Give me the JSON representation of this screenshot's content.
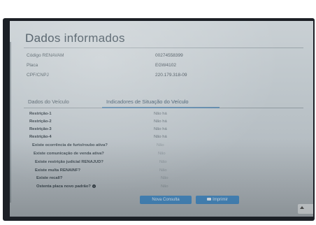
{
  "page": {
    "title": "Dados informados"
  },
  "info": [
    {
      "label": "Código RENAVAM",
      "value": "00274558399"
    },
    {
      "label": "Placa",
      "value": "EGW4102"
    },
    {
      "label": "CPF/CNPJ",
      "value": "220.179.318-09"
    }
  ],
  "tabs": [
    {
      "label": "Dados do Veículo"
    },
    {
      "label": "Indicadores de Situação do Veículo"
    }
  ],
  "status": [
    {
      "label": "Restrição-1",
      "value": "Não há"
    },
    {
      "label": "Restrição-2",
      "value": "Não há"
    },
    {
      "label": "Restrição-3",
      "value": "Não há"
    },
    {
      "label": "Restrição-4",
      "value": "Não há"
    },
    {
      "label": "Existe ocorrência de furto/roubo ativa?",
      "value": "Não"
    },
    {
      "label": "Existe comunicação de venda ativa?",
      "value": "Não"
    },
    {
      "label": "Existe restrição judicial RENAJUD?",
      "value": "Não"
    },
    {
      "label": "Existe multa RENAINF?",
      "value": "Não"
    },
    {
      "label": "Existe recall?",
      "value": "Não"
    },
    {
      "label": "Ostenta placa novo padrão?",
      "value": "Não"
    }
  ],
  "buttons": {
    "new_query": "Nova Consulta",
    "print": "Imprimir"
  },
  "colors": {
    "accent": "#4b90c9",
    "tab_underline": "#5b86a8",
    "screen_bg": "#c9d0d4"
  },
  "icons": {
    "info": "info-circle-icon",
    "print": "printer-icon",
    "scroll_top": "arrow-up-icon"
  }
}
